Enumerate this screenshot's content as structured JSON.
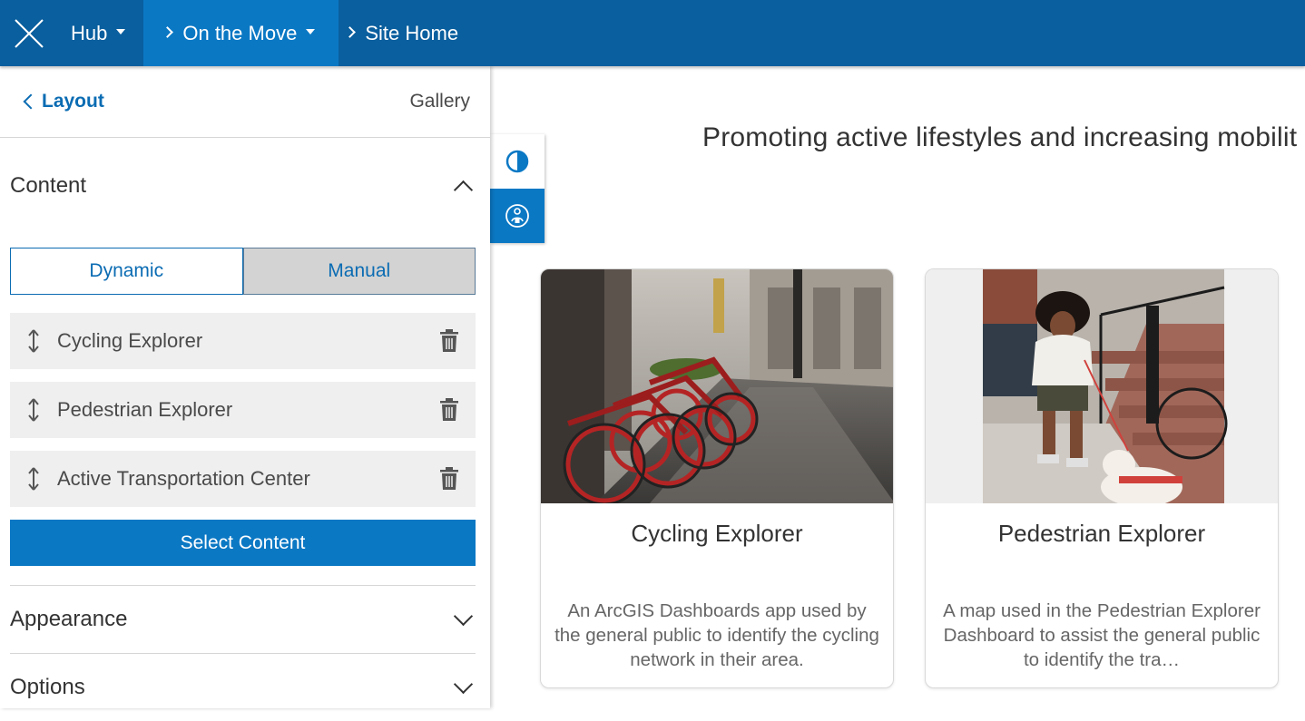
{
  "topbar": {
    "breadcrumbs": [
      {
        "label": "Hub",
        "dropdown": true
      },
      {
        "label": "On the Move",
        "dropdown": true
      },
      {
        "label": "Site Home",
        "dropdown": false
      }
    ]
  },
  "panel": {
    "back_label": "Layout",
    "title": "Gallery",
    "content_section": {
      "title": "Content",
      "toggle": {
        "options": [
          "Dynamic",
          "Manual"
        ],
        "selected": "Manual"
      },
      "items": [
        {
          "label": "Cycling Explorer"
        },
        {
          "label": "Pedestrian Explorer"
        },
        {
          "label": "Active Transportation Center"
        }
      ],
      "select_button": "Select Content"
    },
    "appearance_section": {
      "title": "Appearance"
    },
    "options_section": {
      "title": "Options"
    }
  },
  "main": {
    "hero_text": "Promoting active lifestyles and increasing mobilit",
    "cards": [
      {
        "title": "Cycling Explorer",
        "description": "An ArcGIS Dashboards app used by the general public to identify the cycling network in their area."
      },
      {
        "title": "Pedestrian Explorer",
        "description": "A map used in the Pedestrian Explorer Dashboard to assist the general public to identify the tra…"
      }
    ]
  },
  "colors": {
    "topbar": "#0a5f9e",
    "topbar_active": "#0b78c4",
    "accent": "#0b6cb3",
    "primary_button": "#0b78c4"
  }
}
